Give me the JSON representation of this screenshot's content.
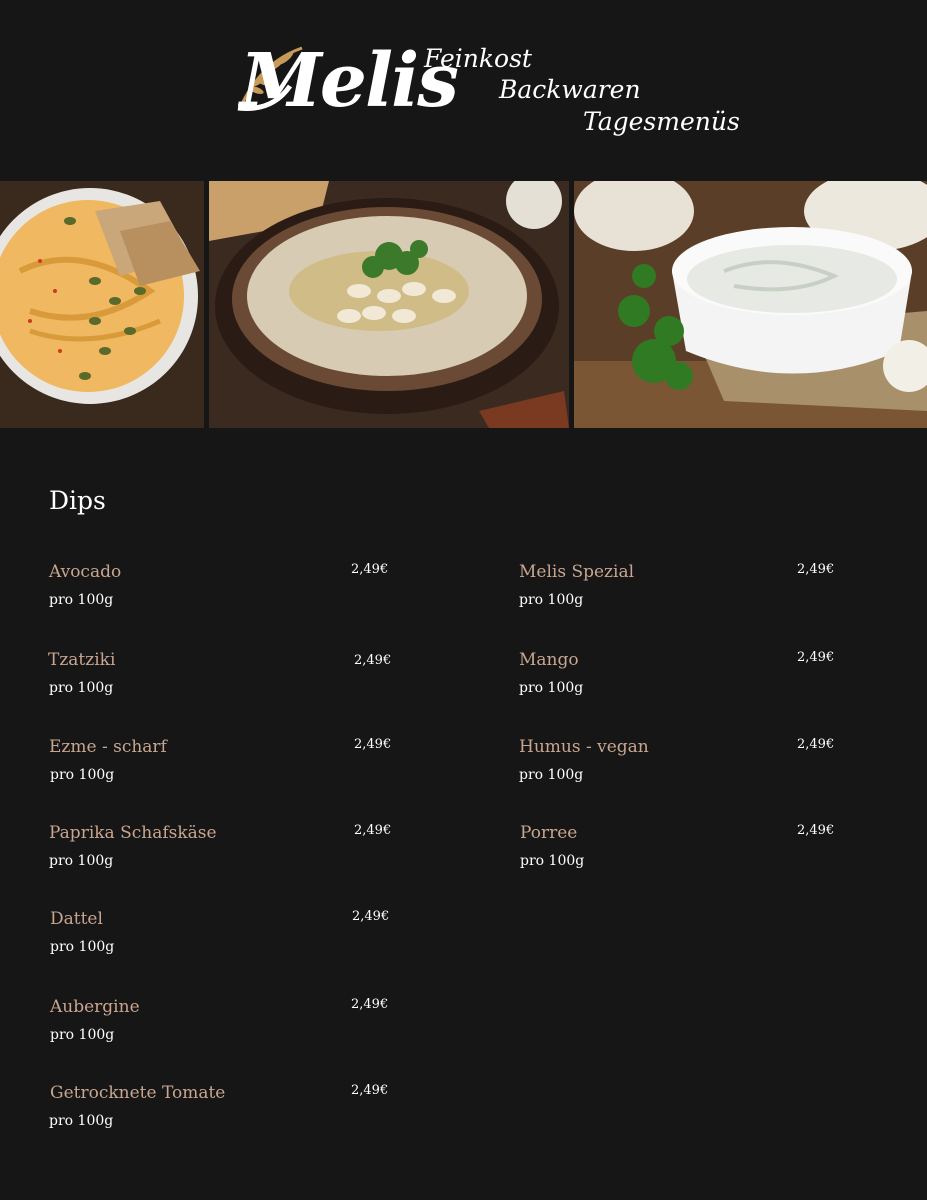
{
  "brand": {
    "logo_text": "Melis",
    "taglines": [
      "Feinkost",
      "Backwaren",
      "Tagesmenüs"
    ]
  },
  "photos": [
    {
      "subject": "hummus with pumpkin seeds and crackers"
    },
    {
      "subject": "white bean dip with parsley"
    },
    {
      "subject": "tzatziki bowl with parsley"
    }
  ],
  "section": {
    "title": "Dips",
    "left_items": [
      {
        "name": "Avocado",
        "unit": "pro 100g",
        "price": "2,49€"
      },
      {
        "name": "Tzatziki",
        "unit": "pro 100g",
        "price": "2,49€"
      },
      {
        "name": "Ezme - scharf",
        "unit": "pro 100g",
        "price": "2,49€"
      },
      {
        "name": "Paprika Schafskäse",
        "unit": "pro 100g",
        "price": "2,49€"
      },
      {
        "name": "Dattel",
        "unit": "pro 100g",
        "price": "2,49€"
      },
      {
        "name": "Aubergine",
        "unit": "pro 100g",
        "price": "2,49€"
      },
      {
        "name": "Getrocknete Tomate",
        "unit": "pro 100g",
        "price": "2,49€"
      }
    ],
    "right_items": [
      {
        "name": "Melis Spezial",
        "unit": "pro 100g",
        "price": "2,49€"
      },
      {
        "name": "Mango",
        "unit": "pro 100g",
        "price": "2,49€"
      },
      {
        "name": "Humus - vegan",
        "unit": "pro 100g",
        "price": "2,49€"
      },
      {
        "name": "Porree",
        "unit": "pro 100g",
        "price": "2,49€"
      }
    ]
  },
  "colors": {
    "background": "#161616",
    "item_name": "#c8a690",
    "text": "#ffffff"
  }
}
